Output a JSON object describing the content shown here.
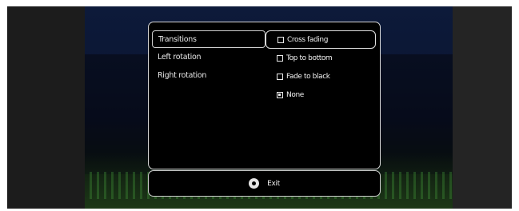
{
  "menu": {
    "items": [
      {
        "label": "Transitions",
        "selected": true
      },
      {
        "label": "Left rotation",
        "selected": false
      },
      {
        "label": "Right rotation",
        "selected": false
      }
    ]
  },
  "options": {
    "items": [
      {
        "label": "Cross fading",
        "checked": false,
        "focused": true
      },
      {
        "label": "Top to bottom",
        "checked": false,
        "focused": false
      },
      {
        "label": "Fade to black",
        "checked": false,
        "focused": false
      },
      {
        "label": "None",
        "checked": true,
        "focused": false
      }
    ]
  },
  "footer": {
    "exit_label": "Exit",
    "exit_icon": "ok-button-icon"
  },
  "colors": {
    "panel_bg": "#000000",
    "border": "#d8d8d8",
    "text": "#f0f0f0"
  }
}
